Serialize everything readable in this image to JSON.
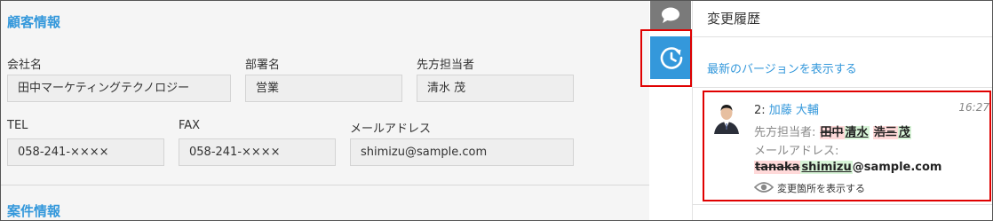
{
  "form": {
    "section1_title": "顧客情報",
    "section2_title": "案件情報",
    "fields": {
      "company": {
        "label": "会社名",
        "value": "田中マーケティングテクノロジー"
      },
      "department": {
        "label": "部署名",
        "value": "営業"
      },
      "contact": {
        "label": "先方担当者",
        "value": "清水 茂"
      },
      "tel": {
        "label": "TEL",
        "value": "058-241-××××"
      },
      "fax": {
        "label": "FAX",
        "value": "058-241-××××"
      },
      "email": {
        "label": "メールアドレス",
        "value": "shimizu@sample.com"
      }
    }
  },
  "panel": {
    "title": "変更履歴",
    "latest_link": "最新のバージョンを表示する",
    "entry": {
      "version": "2:",
      "author": "加藤 大輔",
      "time": "16:27",
      "contact_label": "先方担当者:",
      "contact_old_last": "田中",
      "contact_new_last": "清水",
      "contact_old_first": "浩三",
      "contact_new_first": "茂",
      "email_label": "メールアドレス:",
      "email_old_part": "tanaka",
      "email_new_part": "shimizu",
      "email_rest": "@sample.com",
      "show_changes": "変更箇所を表示する"
    }
  },
  "icons": {
    "chat": "speech-bubble-icon",
    "history": "clock-history-icon",
    "eye": "eye-icon",
    "avatar": "user-avatar"
  },
  "colors": {
    "accent": "#3498db",
    "highlight_border": "#e00000",
    "deleted_bg": "#ffd9d9",
    "inserted_bg": "#d8f5d8"
  }
}
